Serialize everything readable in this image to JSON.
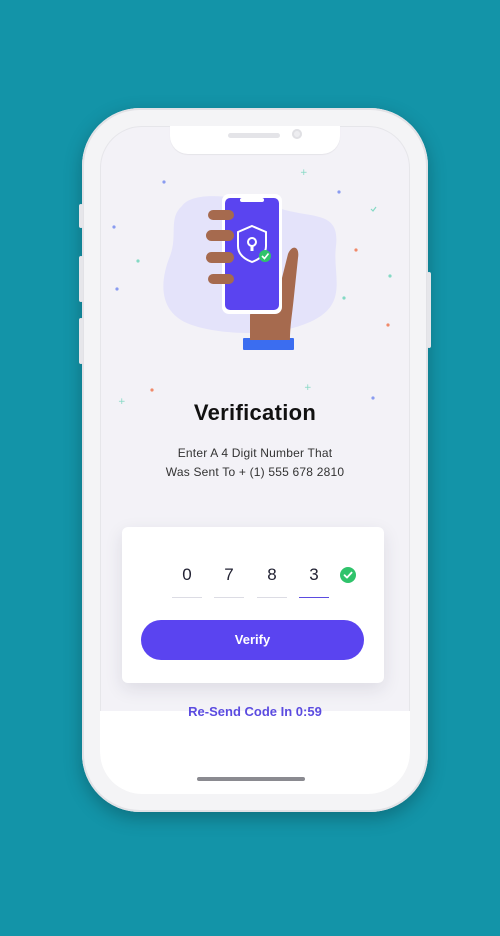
{
  "verification": {
    "title": "Verification",
    "subtitle_line1": "Enter A 4 Digit Number That",
    "subtitle_line2": "Was Sent To + (1) 555 678 2810"
  },
  "code": {
    "digits": [
      "0",
      "7",
      "8",
      "3"
    ],
    "active_index": 3
  },
  "actions": {
    "verify_label": "Verify",
    "resend_label": "Re-Send Code In 0:59"
  },
  "icons": {
    "shield": "shield-lock-icon",
    "check": "check-circle-icon"
  },
  "colors": {
    "background": "#1394a8",
    "accent": "#5a44f0",
    "success": "#2fc36b"
  }
}
